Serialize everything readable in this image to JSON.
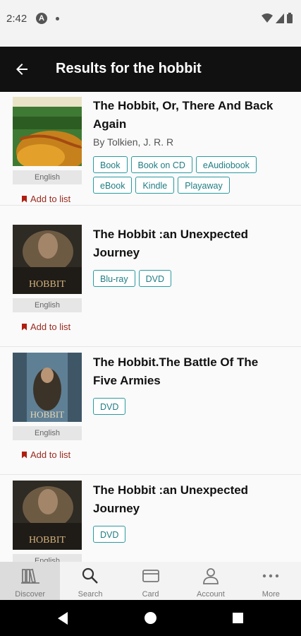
{
  "status": {
    "time": "2:42",
    "a_icon": "A"
  },
  "header": {
    "title": "Results for the hobbit"
  },
  "results": [
    {
      "title": "The Hobbit, Or, There And Back Again",
      "author": "By Tolkien, J. R. R",
      "language": "English",
      "add_label": "Add to list",
      "formats": [
        "Book",
        "Book on CD",
        "eAudiobook",
        "eBook",
        "Kindle",
        "Playaway"
      ]
    },
    {
      "title": "The Hobbit :an Unexpected Journey",
      "language": "English",
      "add_label": "Add to list",
      "formats": [
        "Blu-ray",
        "DVD"
      ]
    },
    {
      "title": "The Hobbit.The Battle Of The Five Armies",
      "language": "English",
      "add_label": "Add to list",
      "formats": [
        "DVD"
      ]
    },
    {
      "title": "The Hobbit :an Unexpected Journey",
      "language": "English",
      "formats": [
        "DVD"
      ]
    }
  ],
  "nav": {
    "discover": "Discover",
    "search": "Search",
    "card": "Card",
    "account": "Account",
    "more": "More"
  },
  "colors": {
    "accent": "#2a9aa0",
    "add_to_list": "#9a2a1e",
    "appbar": "#111111"
  }
}
